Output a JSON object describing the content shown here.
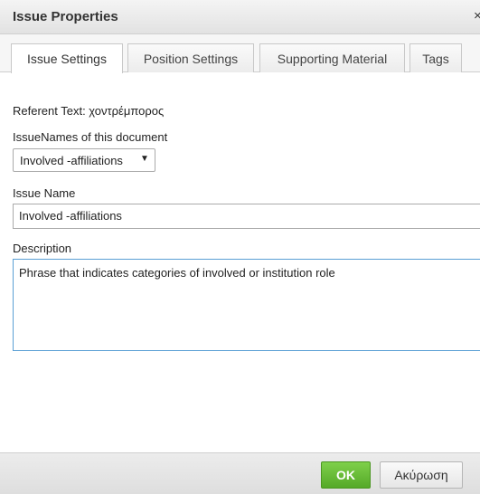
{
  "dialog": {
    "title": "Issue Properties",
    "close_glyph": "×"
  },
  "tabs": [
    {
      "label": "Issue Settings",
      "active": true
    },
    {
      "label": "Position Settings",
      "active": false
    },
    {
      "label": "Supporting Material",
      "active": false
    },
    {
      "label": "Tags",
      "active": false
    }
  ],
  "form": {
    "referent_text": "Referent Text: χοντρέμπορος",
    "issue_names_label": "IssueNames of this document",
    "issue_names_selected": "Involved -affiliations",
    "issue_name_label": "Issue Name",
    "issue_name_value": "Involved -affiliations",
    "description_label": "Description",
    "description_value": "Phrase that indicates categories of involved or institution role"
  },
  "footer": {
    "ok_label": "OK",
    "cancel_label": "Ακύρωση"
  },
  "colors": {
    "ok_button": "#5cb82e",
    "textarea_focus_border": "#5a9fd4"
  }
}
